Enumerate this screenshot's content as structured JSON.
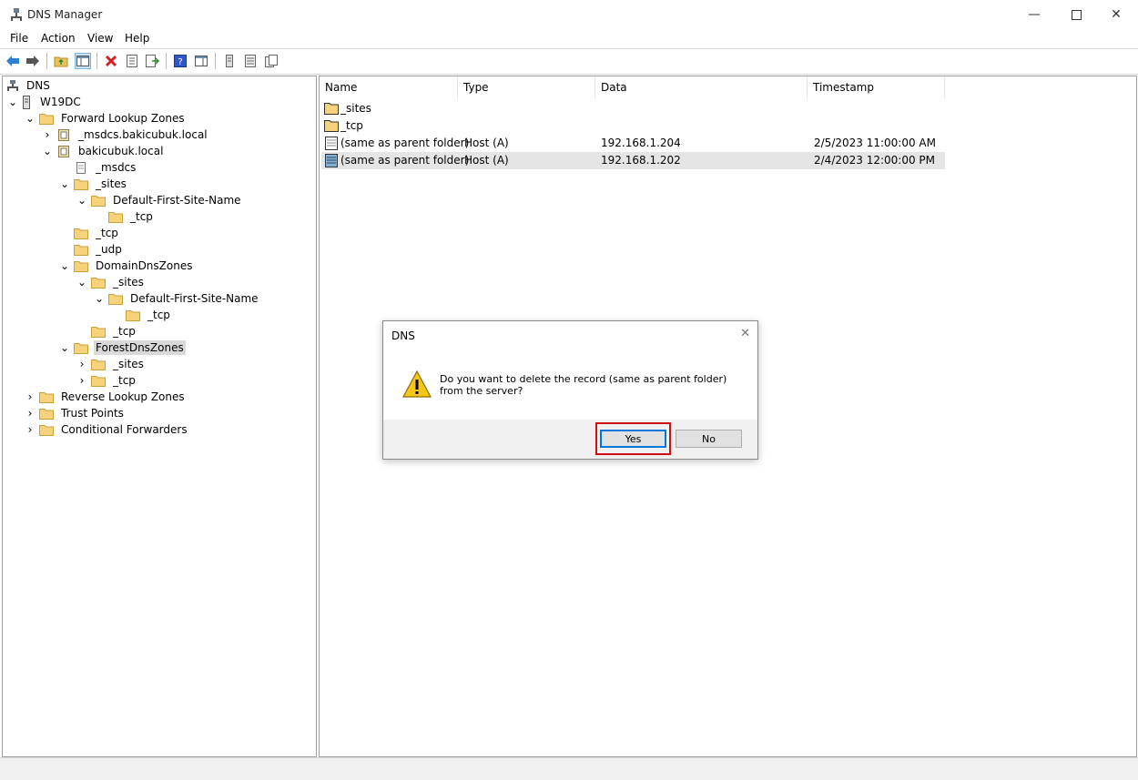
{
  "window": {
    "title": "DNS Manager"
  },
  "menu": {
    "items": [
      "File",
      "Action",
      "View",
      "Help"
    ]
  },
  "tree": {
    "root": "DNS",
    "server": "W19DC",
    "forward_zones": "Forward Lookup Zones",
    "msdcs_zone": "_msdcs.bakicubuk.local",
    "zone": "bakicubuk.local",
    "msdcs": "_msdcs",
    "sites": "_sites",
    "default_site": "Default-First-Site-Name",
    "tcp": "_tcp",
    "udp": "_udp",
    "domain_dns_zones": "DomainDnsZones",
    "forest_dns_zones": "ForestDnsZones",
    "reverse_zones": "Reverse Lookup Zones",
    "trust_points": "Trust Points",
    "conditional_forwarders": "Conditional Forwarders"
  },
  "list": {
    "columns": [
      "Name",
      "Type",
      "Data",
      "Timestamp"
    ],
    "rows": [
      {
        "name": "_sites",
        "type": "",
        "data": "",
        "timestamp": ""
      },
      {
        "name": "_tcp",
        "type": "",
        "data": "",
        "timestamp": ""
      },
      {
        "name": "(same as parent folder)",
        "type": "Host (A)",
        "data": "192.168.1.204",
        "timestamp": "2/5/2023 11:00:00 AM"
      },
      {
        "name": "(same as parent folder)",
        "type": "Host (A)",
        "data": "192.168.1.202",
        "timestamp": "2/4/2023 12:00:00 PM"
      }
    ]
  },
  "dialog": {
    "title": "DNS",
    "message": "Do you want to delete the record (same as parent folder) from the server?",
    "yes_label": "Yes",
    "no_label": "No"
  }
}
